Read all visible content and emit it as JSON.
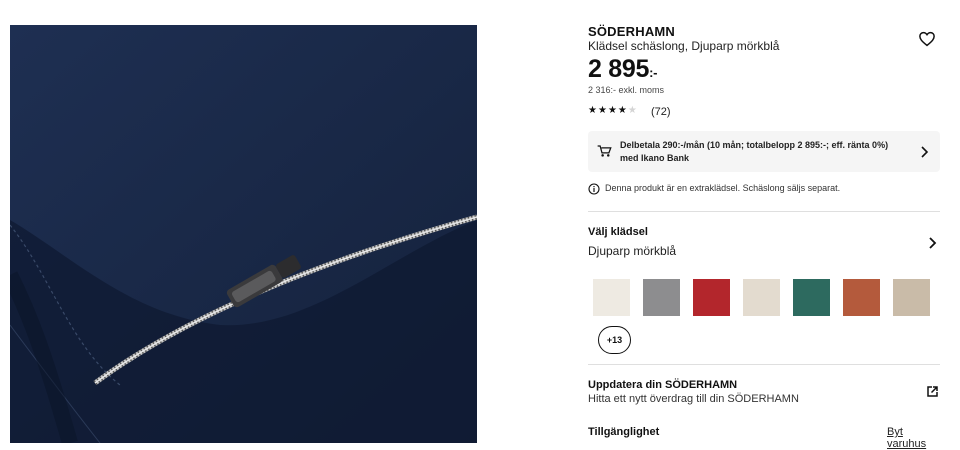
{
  "product": {
    "brand": "SÖDERHAMN",
    "description": "Klädsel schäslong, Djuparp mörkblå",
    "price": "2 895",
    "price_suffix": ":-",
    "price_ex_vat": "2 316:- exkl. moms",
    "rating_stars": 4,
    "rating_max": 5,
    "rating_count": "(72)"
  },
  "finance": {
    "text": "Delbetala 290:-/mån (10 mån; totalbelopp 2 895:-; eff. ränta 0%) med Ikano Bank"
  },
  "notice": {
    "text": "Denna produkt är en extraklädsel. Schäslong säljs separat."
  },
  "cover_selector": {
    "title": "Välj klädsel",
    "selected": "Djuparp mörkblå",
    "swatches": [
      {
        "color": "#eeeae2"
      },
      {
        "color": "#8d8d8f"
      },
      {
        "color": "#b3262c"
      },
      {
        "color": "#e3dbcf"
      },
      {
        "color": "#2d6a5f"
      },
      {
        "color": "#b45a3c"
      },
      {
        "color": "#c9bba8"
      }
    ],
    "more_label": "+13"
  },
  "update": {
    "title": "Uppdatera din SÖDERHAMN",
    "subtitle": "Hitta ett nytt överdrag till din SÖDERHAMN"
  },
  "availability": {
    "title": "Tillgänglighet",
    "change_store": "Byt varuhus"
  },
  "icons": {
    "wishlist": "heart-icon",
    "finance": "shopping-cart-icon",
    "info": "info-icon",
    "chevron": "chevron-right-icon",
    "external": "external-link-icon"
  }
}
